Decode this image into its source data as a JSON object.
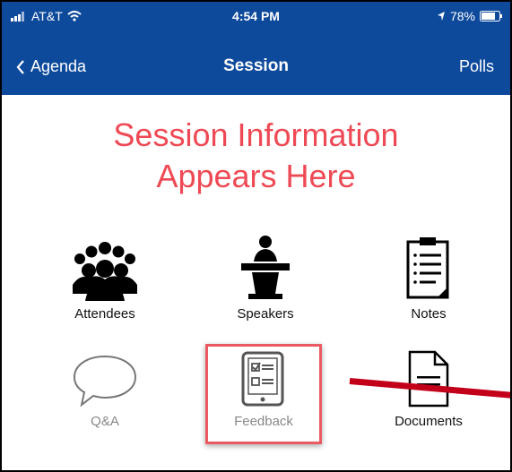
{
  "status_bar": {
    "carrier": "AT&T",
    "time": "4:54 PM",
    "battery": "78%"
  },
  "nav": {
    "back_label": "Agenda",
    "title": "Session",
    "right_label": "Polls"
  },
  "session": {
    "heading_line1": "Session Information",
    "heading_line2": "Appears Here"
  },
  "tiles": [
    {
      "label": "Attendees",
      "icon": "attendees-icon"
    },
    {
      "label": "Speakers",
      "icon": "speaker-podium-icon"
    },
    {
      "label": "Notes",
      "icon": "notes-clipboard-icon"
    },
    {
      "label": "Q&A",
      "icon": "speech-bubble-icon"
    },
    {
      "label": "Feedback",
      "icon": "feedback-tablet-icon"
    },
    {
      "label": "Documents",
      "icon": "document-icon"
    }
  ],
  "colors": {
    "nav_blue": "#0E4A9C",
    "heading_red": "#EE4A55",
    "highlight_red": "#E95A62",
    "arrow_red": "#C3001A"
  }
}
